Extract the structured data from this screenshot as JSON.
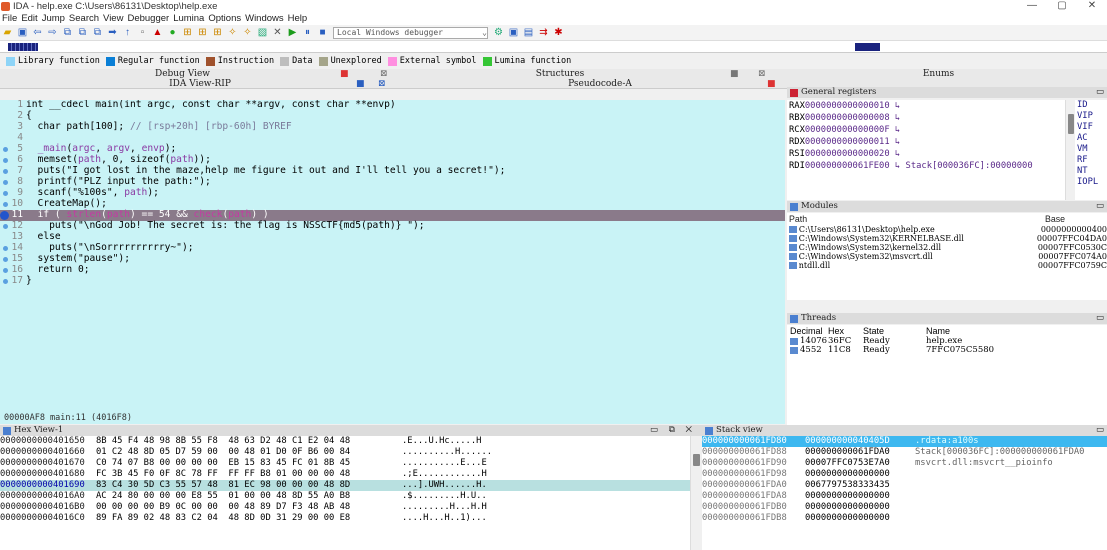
{
  "window": {
    "title": "IDA - help.exe C:\\Users\\86131\\Desktop\\help.exe",
    "minimize": "—",
    "maximize": "▢",
    "close": "✕"
  },
  "menu": [
    "File",
    "Edit",
    "Jump",
    "Search",
    "View",
    "Debugger",
    "Lumina",
    "Options",
    "Windows",
    "Help"
  ],
  "toolbar": {
    "debugger_select": "Local Windows debugger"
  },
  "legend": [
    {
      "label": "Library function",
      "color": "#8ed4f7"
    },
    {
      "label": "Regular function",
      "color": "#0a7fd6"
    },
    {
      "label": "Instruction",
      "color": "#a0522d"
    },
    {
      "label": "Data",
      "color": "#bdbdbd"
    },
    {
      "label": "Unexplored",
      "color": "#a5a58a"
    },
    {
      "label": "External symbol",
      "color": "#ff8fe0"
    },
    {
      "label": "Lumina function",
      "color": "#35c635"
    }
  ],
  "tabs": {
    "top": [
      "Debug View",
      "Structures",
      "Enums"
    ],
    "second": [
      "IDA View-RIP",
      "Pseudocode-A",
      "General registers"
    ]
  },
  "code": {
    "lines": [
      {
        "n": "1",
        "dot": false,
        "text": "int __cdecl main(int argc, const char **argv, const char **envp)"
      },
      {
        "n": "2",
        "dot": false,
        "text": "{"
      },
      {
        "n": "3",
        "dot": false,
        "text": "  char path[100]; // [rsp+20h] [rbp-60h] BYREF"
      },
      {
        "n": "4",
        "dot": false,
        "text": ""
      },
      {
        "n": "5",
        "dot": true,
        "text": "  _main(argc, argv, envp);"
      },
      {
        "n": "6",
        "dot": true,
        "text": "  memset(path, 0, sizeof(path));"
      },
      {
        "n": "7",
        "dot": true,
        "text": "  puts(\"I got lost in the maze,help me figure it out and I'll tell you a secret!\");"
      },
      {
        "n": "8",
        "dot": true,
        "text": "  printf(\"PLZ input the path:\");"
      },
      {
        "n": "9",
        "dot": true,
        "text": "  scanf(\"%100s\", path);"
      },
      {
        "n": "10",
        "dot": true,
        "text": "  CreateMap();"
      },
      {
        "n": "11",
        "dot": true,
        "text": "  if ( strlen(path) == 54 && check(path) )"
      },
      {
        "n": "12",
        "dot": true,
        "text": "    puts(\"\\nGod Job! The secret is: the flag is NSSCTF{md5(path)} \");"
      },
      {
        "n": "13",
        "dot": false,
        "text": "  else"
      },
      {
        "n": "14",
        "dot": true,
        "text": "    puts(\"\\nSorrrrrrrrrry~\");"
      },
      {
        "n": "15",
        "dot": true,
        "text": "  system(\"pause\");"
      },
      {
        "n": "16",
        "dot": true,
        "text": "  return 0;"
      },
      {
        "n": "17",
        "dot": true,
        "text": "}"
      }
    ],
    "status": "00000AF8 main:11 (4016F8)"
  },
  "registers": [
    {
      "name": "RAX",
      "value": "0000000000000010 ↳"
    },
    {
      "name": "RBX",
      "value": "0000000000000008 ↳"
    },
    {
      "name": "RCX",
      "value": "000000000000000F ↳"
    },
    {
      "name": "RDX",
      "value": "0000000000000011 ↳"
    },
    {
      "name": "RSI",
      "value": "0000000000000020 ↳"
    },
    {
      "name": "RDI",
      "value": "000000000061FE00 ↳ Stack[000036FC]:00000000"
    }
  ],
  "flags": [
    "ID",
    "VIP",
    "VIF",
    "AC",
    "VM",
    "RF",
    "NT",
    "IOPL"
  ],
  "modules": {
    "title": "Modules",
    "headers": [
      "Path",
      "Base"
    ],
    "rows": [
      {
        "path": "C:\\Users\\86131\\Desktop\\help.exe",
        "base": "0000000000400"
      },
      {
        "path": "C:\\Windows\\System32\\KERNELBASE.dll",
        "base": "00007FFC04DA0"
      },
      {
        "path": "C:\\Windows\\System32\\kernel32.dll",
        "base": "00007FFC0530C"
      },
      {
        "path": "C:\\Windows\\System32\\msvcrt.dll",
        "base": "00007FFC074A0"
      },
      {
        "path": "ntdll.dll",
        "base": "00007FFC0759C"
      }
    ]
  },
  "threads": {
    "title": "Threads",
    "headers": [
      "Decimal",
      "Hex",
      "State",
      "Name"
    ],
    "rows": [
      {
        "dec": "14076",
        "hex": "36FC",
        "state": "Ready",
        "name": "help.exe"
      },
      {
        "dec": "4552",
        "hex": "11C8",
        "state": "Ready",
        "name": "7FFC075C5580"
      }
    ]
  },
  "hexview": {
    "title": "Hex View-1",
    "rows": [
      {
        "addr": "0000000000401650",
        "bytes": "8B 45 F4 48 98 8B 55 F8  48 63 D2 48 C1 E2 04 48",
        "ascii": ".E...U.Hc.....H"
      },
      {
        "addr": "0000000000401660",
        "bytes": "01 C2 48 8D 05 D7 59 00  00 48 01 D0 0F B6 00 84",
        "ascii": "..........H......"
      },
      {
        "addr": "0000000000401670",
        "bytes": "C0 74 07 B8 00 00 00 00  EB 15 83 45 FC 01 8B 45",
        "ascii": "...........E...E"
      },
      {
        "addr": "0000000000401680",
        "bytes": "FC 3B 45 F0 0F 8C 78 FF  FF FF B8 01 00 00 00 48",
        "ascii": ".;E............H"
      },
      {
        "addr": "0000000000401690",
        "bytes": "83 C4 30 5D C3 55 57 48  81 EC 98 00 00 00 48 8D",
        "ascii": "...].UWH......H."
      },
      {
        "addr": "00000000004016A0",
        "bytes": "AC 24 80 00 00 00 E8 55  01 00 00 48 8D 55 A0 B8",
        "ascii": ".$.........H.U.."
      },
      {
        "addr": "00000000004016B0",
        "bytes": "00 00 00 00 B9 0C 00 00  00 48 89 D7 F3 48 AB 48",
        "ascii": ".........H...H.H"
      },
      {
        "addr": "00000000004016C0",
        "bytes": "89 FA 89 02 48 83 C2 04  48 8D 0D 31 29 00 00 E8",
        "ascii": "....H...H..1)..."
      }
    ]
  },
  "stackview": {
    "title": "Stack view",
    "rows": [
      {
        "addr": "000000000061FD80",
        "val": "000000000040405D",
        "cmt": ".rdata:a100s"
      },
      {
        "addr": "000000000061FD88",
        "val": "000000000061FDA0",
        "cmt": "Stack[000036FC]:000000000061FDA0"
      },
      {
        "addr": "000000000061FD90",
        "val": "00007FFC0753E7A0",
        "cmt": "msvcrt.dll:msvcrt__pioinfo"
      },
      {
        "addr": "000000000061FD98",
        "val": "0000000000000000",
        "cmt": ""
      },
      {
        "addr": "000000000061FDA0",
        "val": "0067797538333435",
        "cmt": ""
      },
      {
        "addr": "000000000061FDA8",
        "val": "0000000000000000",
        "cmt": ""
      },
      {
        "addr": "000000000061FDB0",
        "val": "0000000000000000",
        "cmt": ""
      },
      {
        "addr": "000000000061FDB8",
        "val": "0000000000000000",
        "cmt": ""
      }
    ]
  }
}
